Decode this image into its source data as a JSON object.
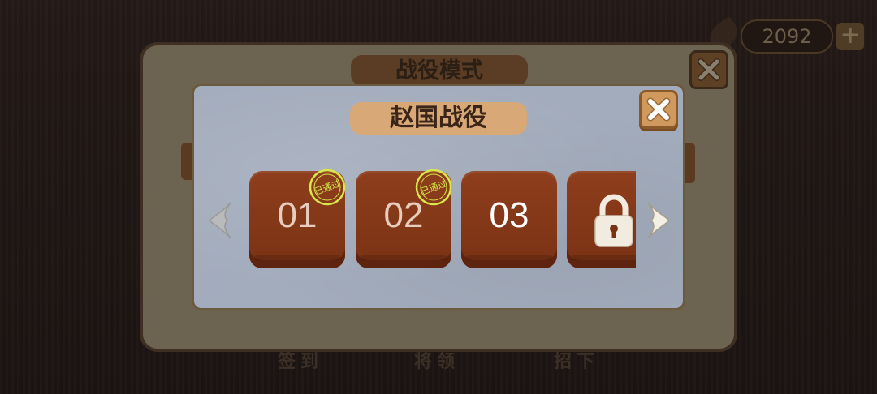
{
  "currency": {
    "amount": "2092",
    "add_label": "+"
  },
  "bottom_nav": {
    "items": [
      "签到",
      "将领",
      "招下"
    ]
  },
  "outer_dialog": {
    "title": "战役模式"
  },
  "campaign_dialog": {
    "title": "赵国战役",
    "levels": [
      {
        "label": "01",
        "status": "cleared",
        "stamp": "已通过"
      },
      {
        "label": "02",
        "status": "cleared",
        "stamp": "已通过"
      },
      {
        "label": "03",
        "status": "available"
      },
      {
        "label": "",
        "status": "locked"
      }
    ]
  },
  "colors": {
    "tile": "#8e3e1c",
    "panel": "#a3acbc",
    "title_plate": "#d8a877",
    "stamp": "#d8e84a"
  },
  "icons": [
    "feather-icon",
    "plus-icon",
    "close-icon",
    "arrow-left-icon",
    "arrow-right-icon",
    "lock-icon",
    "cleared-stamp-icon"
  ]
}
